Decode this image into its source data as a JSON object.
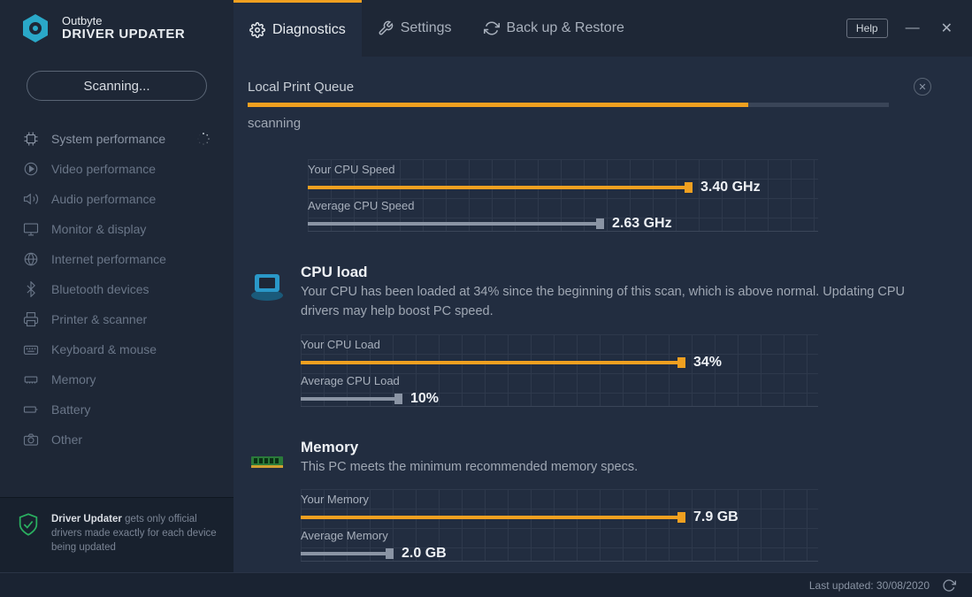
{
  "brand": {
    "line1": "Outbyte",
    "line2": "DRIVER UPDATER"
  },
  "tabs": [
    {
      "label": "Diagnostics",
      "active": true
    },
    {
      "label": "Settings",
      "active": false
    },
    {
      "label": "Back up & Restore",
      "active": false
    }
  ],
  "help_label": "Help",
  "scan_button": "Scanning...",
  "sidebar_items": [
    "System performance",
    "Video performance",
    "Audio performance",
    "Monitor & display",
    "Internet performance",
    "Bluetooth devices",
    "Printer & scanner",
    "Keyboard & mouse",
    "Memory",
    "Battery",
    "Other"
  ],
  "sidebar_footer": {
    "bold": "Driver Updater",
    "rest": " gets only official drivers made exactly for each device being updated"
  },
  "scan": {
    "queue": "Local Print Queue",
    "status": "scanning",
    "progress_pct": 78
  },
  "cpu_speed": {
    "your_label": "Your CPU Speed",
    "your_value": "3.40 GHz",
    "your_pct": 98,
    "avg_label": "Average CPU Speed",
    "avg_value": "2.63 GHz",
    "avg_pct": 75
  },
  "cpu_load": {
    "title": "CPU load",
    "desc": "Your CPU has been loaded at 34% since the beginning of this scan, which is above normal. Updating CPU drivers may help boost PC speed.",
    "your_label": "Your CPU Load",
    "your_value": "34%",
    "your_pct": 98,
    "avg_label": "Average CPU Load",
    "avg_value": "10%",
    "avg_pct": 24
  },
  "memory": {
    "title": "Memory",
    "desc": "This PC meets the minimum recommended memory specs.",
    "your_label": "Your Memory",
    "your_value": "7.9 GB",
    "your_pct": 98,
    "avg_label": "Average Memory",
    "avg_value": "2.0 GB",
    "avg_pct": 22
  },
  "footer": {
    "last_updated": "Last updated: 30/08/2020"
  },
  "chart_data": [
    {
      "type": "bar",
      "title": "CPU Speed",
      "series": [
        {
          "name": "Your CPU Speed",
          "values": [
            3.4
          ],
          "unit": "GHz"
        },
        {
          "name": "Average CPU Speed",
          "values": [
            2.63
          ],
          "unit": "GHz"
        }
      ]
    },
    {
      "type": "bar",
      "title": "CPU load",
      "series": [
        {
          "name": "Your CPU Load",
          "values": [
            34
          ],
          "unit": "%"
        },
        {
          "name": "Average CPU Load",
          "values": [
            10
          ],
          "unit": "%"
        }
      ]
    },
    {
      "type": "bar",
      "title": "Memory",
      "series": [
        {
          "name": "Your Memory",
          "values": [
            7.9
          ],
          "unit": "GB"
        },
        {
          "name": "Average Memory",
          "values": [
            2.0
          ],
          "unit": "GB"
        }
      ]
    }
  ]
}
